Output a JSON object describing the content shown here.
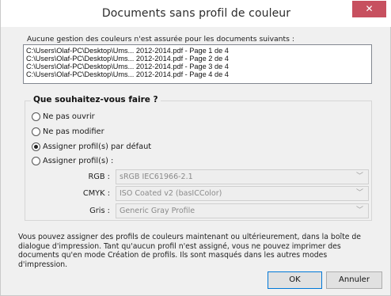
{
  "window": {
    "title": "Documents sans profil de couleur",
    "close_glyph": "✕"
  },
  "list_label": "Aucune gestion des couleurs n'est assurée pour les documents suivants :",
  "documents": [
    "C:\\Users\\Olaf-PC\\Desktop\\Ums... 2012-2014.pdf - Page 1 de 4",
    "C:\\Users\\Olaf-PC\\Desktop\\Ums... 2012-2014.pdf - Page 2 de 4",
    "C:\\Users\\Olaf-PC\\Desktop\\Ums... 2012-2014.pdf - Page 3 de 4",
    "C:\\Users\\Olaf-PC\\Desktop\\Ums... 2012-2014.pdf - Page 4 de 4"
  ],
  "options": {
    "legend": "Que souhaitez-vous faire ?",
    "items": [
      {
        "label": "Ne pas ouvrir",
        "selected": false
      },
      {
        "label": "Ne pas modifier",
        "selected": false
      },
      {
        "label": "Assigner profil(s) par défaut",
        "selected": true
      },
      {
        "label": "Assigner profil(s) :",
        "selected": false
      }
    ]
  },
  "profiles": {
    "rgb": {
      "label": "RGB :",
      "value": "sRGB IEC61966-2.1"
    },
    "cmyk": {
      "label": "CMYK :",
      "value": "ISO Coated v2 (basICColor)"
    },
    "gray": {
      "label": "Gris :",
      "value": "Generic Gray Profile"
    }
  },
  "info_text": "Vous pouvez assigner des profils de couleurs maintenant ou ultérieurement, dans la boîte de dialogue d'impression. Tant qu'aucun profil n'est assigné, vous ne pouvez imprimer des documents qu'en mode Création de profils. Ils sont masqués dans les autres modes d'impression.",
  "buttons": {
    "ok": "OK",
    "cancel": "Annuler"
  },
  "colors": {
    "close_button": "#c7505f",
    "default_button_border": "#0078d7"
  }
}
